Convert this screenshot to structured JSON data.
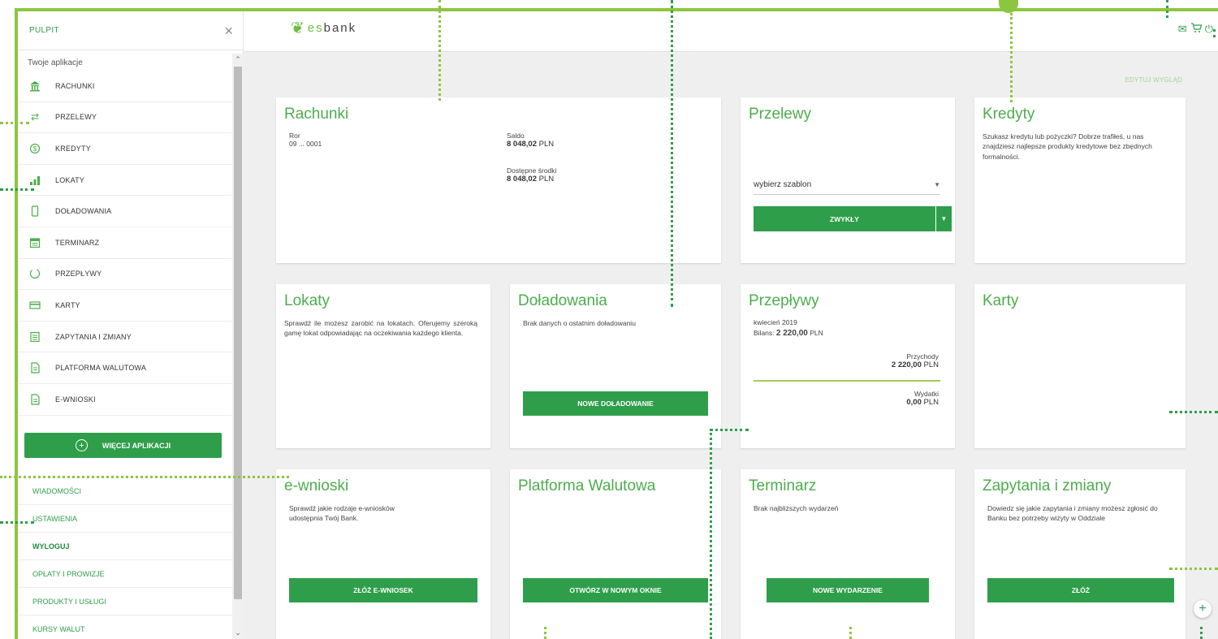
{
  "sidebar": {
    "title": "PULPIT",
    "close": "×",
    "subtitle": "Twoje aplikacje",
    "items": [
      {
        "label": "RACHUNKI",
        "icon": "bank-icon"
      },
      {
        "label": "PRZELEWY",
        "icon": "transfer-icon"
      },
      {
        "label": "KREDYTY",
        "icon": "credit-icon"
      },
      {
        "label": "LOKATY",
        "icon": "chart-bars-icon"
      },
      {
        "label": "DOŁADOWANIA",
        "icon": "phone-icon"
      },
      {
        "label": "TERMINARZ",
        "icon": "calendar-icon"
      },
      {
        "label": "PRZEPŁYWY",
        "icon": "flow-icon"
      },
      {
        "label": "KARTY",
        "icon": "card-icon"
      },
      {
        "label": "ZAPYTANIA I ZMIANY",
        "icon": "form-icon"
      },
      {
        "label": "PLATFORMA WALUTOWA",
        "icon": "document-icon"
      },
      {
        "label": "E-WNIOSKI",
        "icon": "document-icon"
      }
    ],
    "more_button": "WIĘCEJ APLIKACJI",
    "links": [
      {
        "label": "WIADOMOŚCI",
        "bold": false
      },
      {
        "label": "USTAWIENIA",
        "bold": false
      },
      {
        "label": "WYLOGUJ",
        "bold": true
      },
      {
        "label": "OPŁATY I PROWIZJE",
        "bold": false
      },
      {
        "label": "PRODUKTY I USŁUGI",
        "bold": false
      },
      {
        "label": "KURSY WALUT",
        "bold": false
      }
    ]
  },
  "header": {
    "logo_prefix": "es",
    "logo_suffix": "bank",
    "icons": [
      "mail-icon",
      "cart-icon",
      "power-icon"
    ]
  },
  "main": {
    "edit_link": "EDYTUJ WYGLĄD",
    "rachunki": {
      "title": "Rachunki",
      "account_name": "Ror",
      "account_number": "09 ... 0001",
      "balance_label": "Saldo",
      "balance_value": "8 048,02",
      "balance_currency": "PLN",
      "available_label": "Dostępne środki",
      "available_value": "8 048,02",
      "available_currency": "PLN"
    },
    "przelewy": {
      "title": "Przelewy",
      "select_value": "wybierz szablon",
      "button": "ZWYKŁY"
    },
    "kredyty": {
      "title": "Kredyty",
      "text": "Szukasz kredytu lub pożyczki? Dobrze trafiłeś, u nas znajdziesz najlepsze produkty kredytowe bez zbędnych formalności."
    },
    "lokaty": {
      "title": "Lokaty",
      "text": "Sprawdź ile możesz zarobić na lokatach. Oferujemy szeroką gamę lokat odpowiadając na oczekiwania każdego klienta."
    },
    "doladowania": {
      "title": "Doładowania",
      "text": "Brak danych o ostatnim doładowaniu",
      "button": "NOWE DOŁADOWANIE"
    },
    "przeplywy": {
      "title": "Przepływy",
      "period": "kwiecień 2019",
      "balance_label": "Bilans:",
      "balance_value": "2 220,00",
      "balance_currency": "PLN",
      "income_label": "Przychody",
      "income_value": "2 220,00",
      "income_currency": "PLN",
      "expense_label": "Wydatki",
      "expense_value": "0,00",
      "expense_currency": "PLN"
    },
    "karty": {
      "title": "Karty"
    },
    "ewnioski": {
      "title": "e-wnioski",
      "text": "Sprawdź jakie rodzaje e-wniosków udostępnia Twój Bank.",
      "button": "ZŁÓŻ E-WNIOSEK"
    },
    "platforma": {
      "title": "Platforma Walutowa",
      "button": "OTWÓRZ W NOWYM OKNIE"
    },
    "terminarz": {
      "title": "Terminarz",
      "text": "Brak najbliższych wydarzeń",
      "button": "NOWE WYDARZENIE"
    },
    "zapytania": {
      "title": "Zapytania i zmiany",
      "text": "Dowiedz się jakie zapytania i zmiany możesz zgłosić do Banku bez potrzeby wizyty w Oddziale",
      "button": "ZŁÓŻ"
    },
    "fab": "+"
  }
}
